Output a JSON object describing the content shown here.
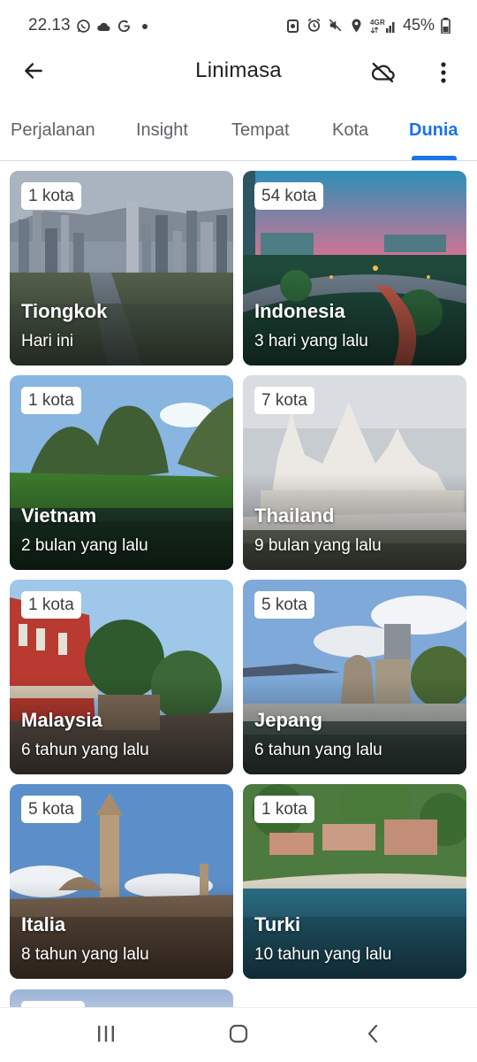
{
  "status_bar": {
    "time": "22.13",
    "battery": "45%",
    "left_icons": [
      "whatsapp-icon",
      "cloud-icon",
      "google-icon",
      "dot-icon"
    ],
    "right_icons": [
      "alarm-badge-icon",
      "alarm-icon",
      "mute-icon",
      "location-icon",
      "signal-4g-icon"
    ]
  },
  "app_bar": {
    "title": "Linimasa",
    "back_icon": "arrow-back-icon",
    "cloud_icon": "cloud-off-icon",
    "more_icon": "more-vert-icon"
  },
  "tabs": [
    {
      "label": "Perjalanan",
      "active": false
    },
    {
      "label": "Insight",
      "active": false
    },
    {
      "label": "Tempat",
      "active": false
    },
    {
      "label": "Kota",
      "active": false
    },
    {
      "label": "Dunia",
      "active": true
    }
  ],
  "colors": {
    "accent": "#1a73e8",
    "text_primary": "#202124",
    "text_secondary": "#5f6368"
  },
  "countries": [
    {
      "name": "Tiongkok",
      "badge": "1 kota",
      "subtitle": "Hari ini"
    },
    {
      "name": "Indonesia",
      "badge": "54 kota",
      "subtitle": "3 hari yang lalu"
    },
    {
      "name": "Vietnam",
      "badge": "1 kota",
      "subtitle": "2 bulan yang lalu"
    },
    {
      "name": "Thailand",
      "badge": "7 kota",
      "subtitle": "9 bulan yang lalu"
    },
    {
      "name": "Malaysia",
      "badge": "1 kota",
      "subtitle": "6 tahun yang lalu"
    },
    {
      "name": "Jepang",
      "badge": "5 kota",
      "subtitle": "6 tahun yang lalu"
    },
    {
      "name": "Italia",
      "badge": "5 kota",
      "subtitle": "8 tahun yang lalu"
    },
    {
      "name": "Turki",
      "badge": "1 kota",
      "subtitle": "10 tahun yang lalu"
    }
  ],
  "nav_bar": {
    "recents_icon": "recents-icon",
    "home_icon": "home-icon",
    "back_icon": "nav-back-icon"
  }
}
